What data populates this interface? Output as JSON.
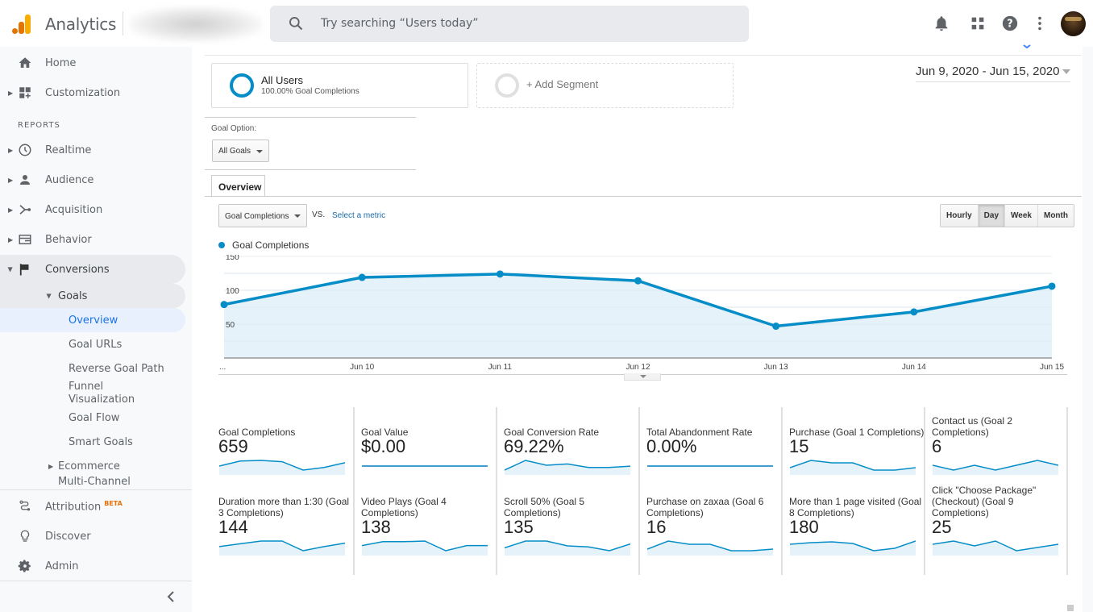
{
  "app": {
    "title": "Analytics"
  },
  "search": {
    "placeholder": "Try searching “Users today”"
  },
  "topbar_icons": [
    "bell-icon",
    "apps-grid-icon",
    "help-icon",
    "more-vert-icon",
    "avatar"
  ],
  "sidebar": {
    "top_items": [
      {
        "label": "Home",
        "icon": "home-icon"
      },
      {
        "label": "Customization",
        "icon": "dashboard-plus-icon"
      }
    ],
    "reports_header": "REPORTS",
    "report_items": [
      {
        "label": "Realtime",
        "icon": "clock-icon"
      },
      {
        "label": "Audience",
        "icon": "person-icon"
      },
      {
        "label": "Acquisition",
        "icon": "acquisition-icon"
      },
      {
        "label": "Behavior",
        "icon": "behavior-icon"
      },
      {
        "label": "Conversions",
        "icon": "flag-icon"
      }
    ],
    "goals_label": "Goals",
    "goals_children": [
      "Overview",
      "Goal URLs",
      "Reverse Goal Path",
      "Funnel Visualization",
      "Goal Flow",
      "Smart Goals"
    ],
    "ecommerce_label": "Ecommerce",
    "multichannel_label": "Multi-Channel",
    "bottom_items": [
      {
        "label": "Attribution",
        "icon": "attribution-icon",
        "badge": "BETA"
      },
      {
        "label": "Discover",
        "icon": "lightbulb-icon"
      },
      {
        "label": "Admin",
        "icon": "gear-icon"
      }
    ],
    "collapse_icon": "chevron-left-icon"
  },
  "segments": {
    "all_users": {
      "name": "All Users",
      "sub": "100.00% Goal Completions"
    },
    "add_segment": "+ Add Segment"
  },
  "date_range": "Jun 9, 2020 - Jun 15, 2020",
  "goal_option": {
    "label": "Goal Option:",
    "selected": "All Goals"
  },
  "tabs": [
    {
      "label": "Overview",
      "active": true
    }
  ],
  "metric_selector": {
    "selected": "Goal Completions",
    "vs": "VS.",
    "link": "Select a metric"
  },
  "time_buttons": [
    {
      "label": "Hourly",
      "active": false
    },
    {
      "label": "Day",
      "active": true
    },
    {
      "label": "Week",
      "active": false
    },
    {
      "label": "Month",
      "active": false
    }
  ],
  "colors": {
    "series": "#058dc7",
    "fill": "#e5f2f9",
    "selected_nav": "#1a73e8"
  },
  "chart_data": {
    "type": "area",
    "title": "",
    "legend": [
      "Goal Completions"
    ],
    "legend_position": "top-left",
    "x": [
      "...",
      "Jun 10",
      "Jun 11",
      "Jun 12",
      "Jun 13",
      "Jun 14",
      "Jun 15"
    ],
    "series": [
      {
        "name": "Goal Completions",
        "values": [
          79,
          119,
          124,
          114,
          47,
          68,
          106
        ]
      }
    ],
    "yticks": [
      50,
      100,
      150
    ],
    "ylim": [
      0,
      150
    ],
    "grid": true
  },
  "scorecards": [
    {
      "title": "Goal Completions",
      "value": "659",
      "spark": [
        79,
        119,
        124,
        114,
        47,
        68,
        106
      ]
    },
    {
      "title": "Goal Value",
      "value": "$0.00",
      "spark": [
        0,
        0,
        0,
        0,
        0,
        0,
        0
      ]
    },
    {
      "title": "Goal Conversion Rate",
      "value": "69.22%",
      "spark": [
        60,
        82,
        71,
        74,
        66,
        66,
        69
      ]
    },
    {
      "title": "Total Abandonment Rate",
      "value": "0.00%",
      "spark": [
        0,
        0,
        0,
        0,
        0,
        0,
        0
      ]
    },
    {
      "title": "Purchase (Goal 1 Completions)",
      "value": "15",
      "spark": [
        1,
        4,
        3,
        3,
        0,
        0,
        1
      ]
    },
    {
      "title": "Contact us (Goal 2 Completions)",
      "value": "6",
      "spark": [
        1,
        0,
        1,
        0,
        1,
        2,
        1
      ]
    },
    {
      "title": "Duration more than 1:30 (Goal 3 Completions)",
      "value": "144",
      "spark": [
        18,
        22,
        26,
        26,
        12,
        18,
        23
      ]
    },
    {
      "title": "Video Plays (Goal 4 Completions)",
      "value": "138",
      "spark": [
        18,
        24,
        24,
        25,
        10,
        18,
        18
      ]
    },
    {
      "title": "Scroll 50% (Goal 5 Completions)",
      "value": "135",
      "spark": [
        18,
        25,
        25,
        20,
        19,
        15,
        22
      ]
    },
    {
      "title": "Purchase on zaxaa (Goal 6 Completions)",
      "value": "16",
      "spark": [
        1,
        6,
        4,
        4,
        0,
        0,
        1
      ]
    },
    {
      "title": "More than 1 page visited (Goal 8 Completions)",
      "value": "180",
      "spark": [
        26,
        28,
        29,
        27,
        18,
        21,
        30
      ]
    },
    {
      "title": "Click \"Choose Package\" (Checkout) (Goal 9 Completions)",
      "value": "25",
      "spark": [
        4,
        6,
        3,
        6,
        0,
        2,
        4
      ]
    }
  ]
}
